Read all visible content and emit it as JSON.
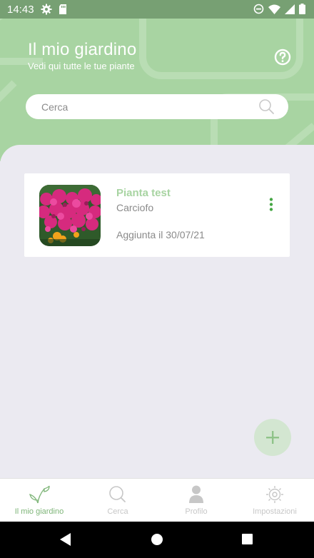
{
  "status_bar": {
    "time": "14:43",
    "left_icons": [
      "gear-icon",
      "sd-card-icon"
    ],
    "right_icons": [
      "do-not-disturb-icon",
      "wifi-icon",
      "signal-icon",
      "battery-icon"
    ]
  },
  "header": {
    "title": "Il mio giardino",
    "subtitle": "Vedi qui tutte le tue piante",
    "help_icon": "help-circle-icon",
    "background_color": "#a8d4a2"
  },
  "search": {
    "placeholder": "Cerca",
    "icon": "search-icon"
  },
  "plants": [
    {
      "name": "Pianta test",
      "species": "Carciofo",
      "added": "Aggiunta il 30/07/21",
      "thumbnail": "flower-photo",
      "menu_icon": "more-vertical-icon"
    }
  ],
  "fab": {
    "icon": "plus-icon"
  },
  "bottom_nav": {
    "items": [
      {
        "label": "Il mio giardino",
        "icon": "sprout-icon",
        "active": true
      },
      {
        "label": "Cerca",
        "icon": "search-icon",
        "active": false
      },
      {
        "label": "Profilo",
        "icon": "person-icon",
        "active": false
      },
      {
        "label": "Impostazioni",
        "icon": "gear-icon",
        "active": false
      }
    ]
  },
  "colors": {
    "accent": "#a8d4a2",
    "accent_dark": "#77a073",
    "nav_active": "#7eb578",
    "background": "#ebeaf1"
  }
}
